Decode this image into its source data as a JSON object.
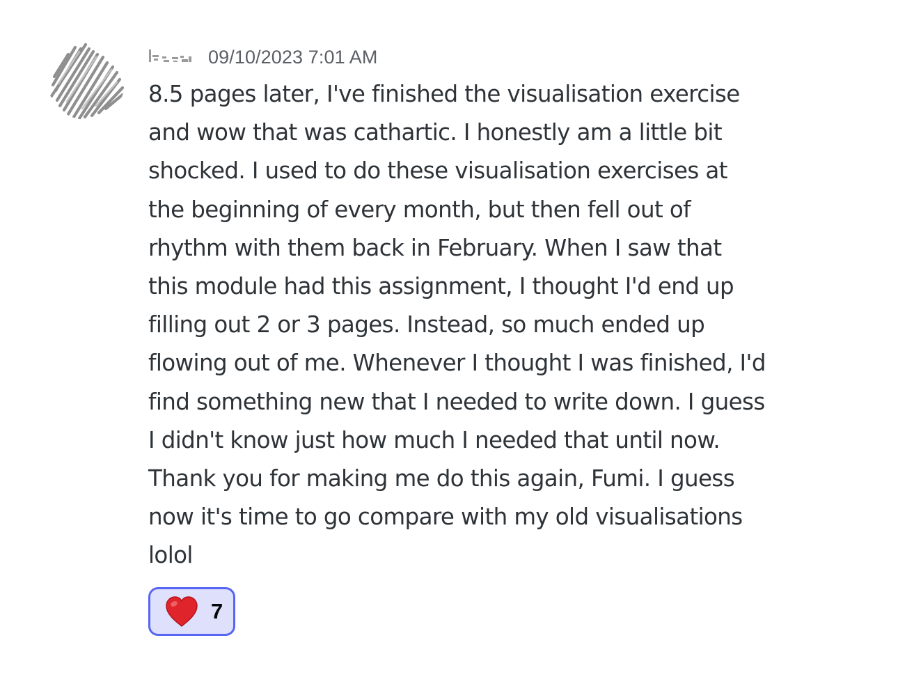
{
  "message": {
    "timestamp": "09/10/2023 7:01 AM",
    "content_lines": [
      "8.5 pages later, I've finished the visualisation exercise",
      "and wow that was cathartic. I honestly am a little bit",
      "shocked. I used to do these visualisation exercises at",
      "the beginning of every month, but then fell out of",
      "rhythm with them back in February. When I saw that",
      "this module had this assignment, I thought I'd end up",
      "filling out 2 or 3 pages. Instead, so much ended up",
      "flowing out of me. Whenever I thought I was finished, I'd",
      "find something new that I needed to write down. I guess",
      "I didn't know just how much I needed that until now.",
      "Thank you for making me do this again, Fumi. I guess",
      "now it's time to go compare with my old visualisations",
      "lolol"
    ],
    "reaction": {
      "emoji": "heart-icon",
      "count": "7"
    }
  },
  "colors": {
    "text": "#2e3338",
    "timestamp": "#5c5e66",
    "reaction_border": "#5865f2",
    "reaction_bg": "#dee0fc",
    "heart": "#e0242b"
  }
}
